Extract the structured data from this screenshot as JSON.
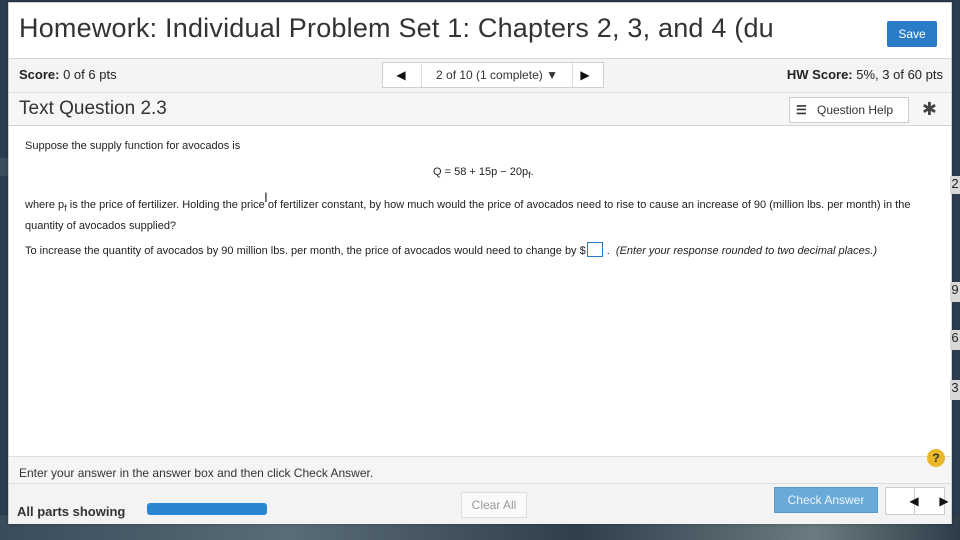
{
  "window": {
    "title": "Homework: Individual Problem Set 1: Chapters 2, 3, and 4 (du",
    "save_label": "Save"
  },
  "scorebar": {
    "score_label": "Score:",
    "score_value": "0 of 6 pts",
    "nav_position": "2 of 10 (1 complete)",
    "hw_score_label": "HW Score:",
    "hw_score_value": "5%, 3 of 60 pts"
  },
  "question": {
    "title": "Text Question 2.3",
    "help_label": "Question Help",
    "intro": "Suppose the supply function for avocados is",
    "equation": "Q = 58 + 15p − 20p",
    "equation_subscript": "f",
    "equation_end": ".",
    "body_part1": "where p",
    "body_sub": "f",
    "body_part2": " is the price of fertilizer. Holding the price of fertilizer constant, by how much would the price of avocados need to rise to cause an increase of 90 (million lbs. per month) in the quantity of avocados supplied?",
    "prompt_before": "To increase the quantity of avocados by 90 million lbs. per month, the price of avocados would need to change by $",
    "prompt_after": ".",
    "prompt_hint": "(Enter your response rounded to two decimal places.)"
  },
  "instruction": {
    "text": "Enter your answer in the answer box and then click Check Answer.",
    "help_symbol": "?"
  },
  "bottombar": {
    "all_parts_label": "All parts showing",
    "progress_fraction": 1.0,
    "clear_label": "Clear All",
    "check_label": "Check Answer"
  },
  "edge_fragments": [
    "2",
    "9",
    "6",
    "3"
  ],
  "colors": {
    "accent": "#2a7cc7",
    "check_button": "#6aaad8",
    "help_badge": "#e8b829"
  },
  "icons": {
    "nav_prev": "triangle-left-icon",
    "nav_next": "triangle-right-icon",
    "dropdown": "chevron-down-icon",
    "question_help": "list-icon",
    "settings": "gear-icon"
  }
}
